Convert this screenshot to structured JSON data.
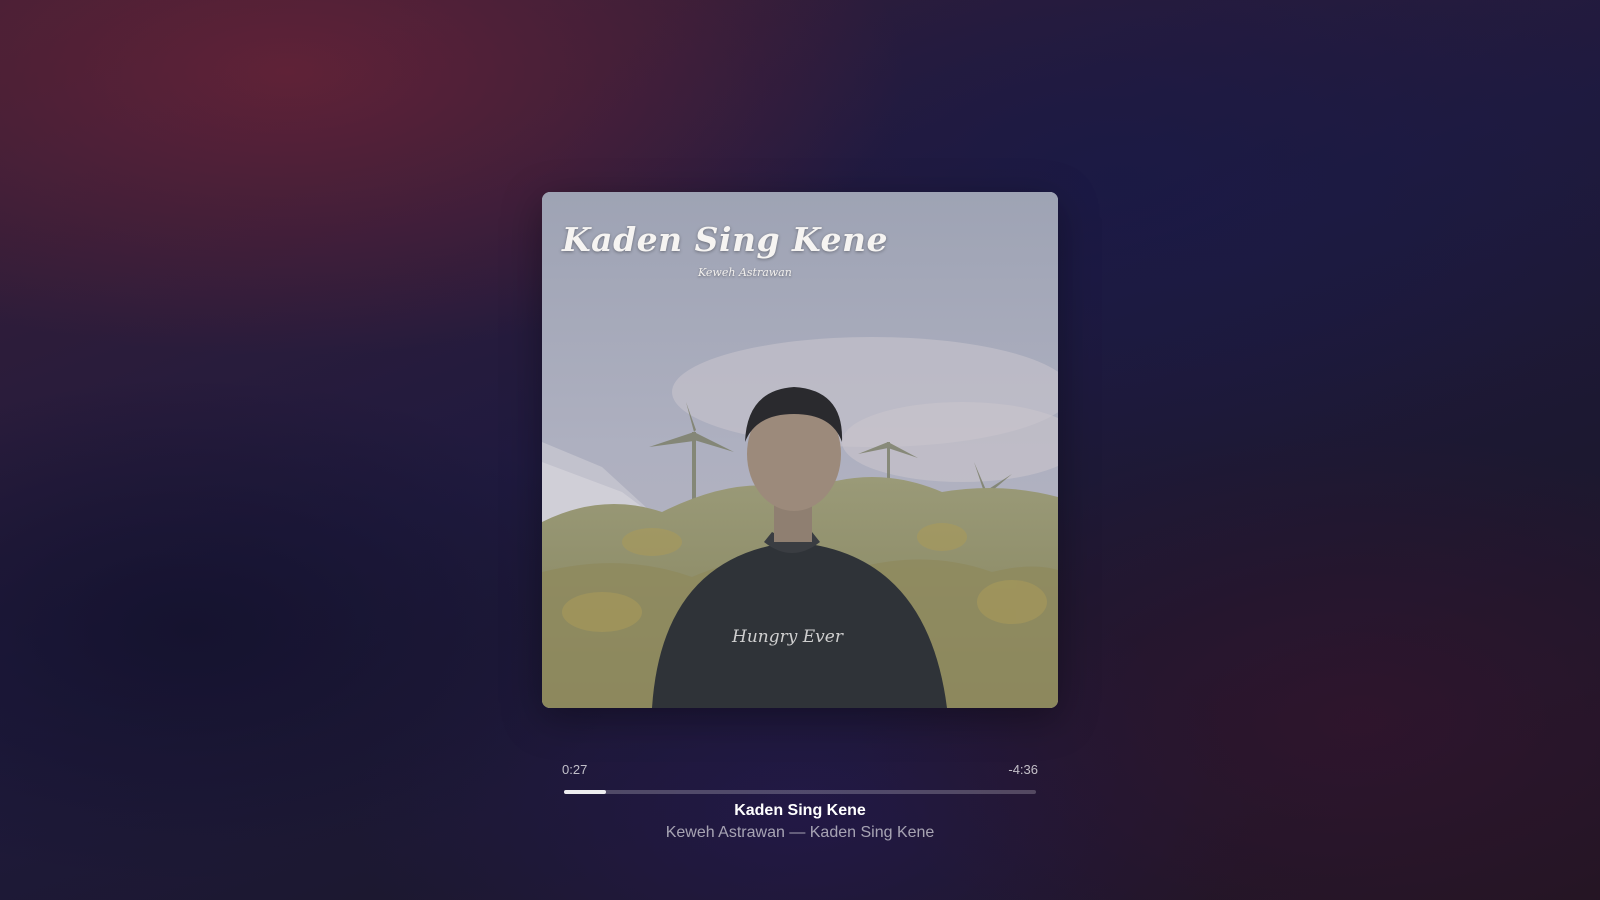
{
  "artwork": {
    "title_text": "Kaden Sing Kene",
    "artist_text": "Keweh Astrawan",
    "shirt_text": "Hungry Ever"
  },
  "playback": {
    "elapsed": "0:27",
    "remaining": "-4:36",
    "progress_fraction": 0.089
  },
  "track": {
    "title": "Kaden Sing Kene",
    "subtitle": "Keweh Astrawan — Kaden Sing Kene"
  },
  "colors": {
    "progress_fill": "#e6e6e6",
    "progress_track": "#5a5470"
  }
}
